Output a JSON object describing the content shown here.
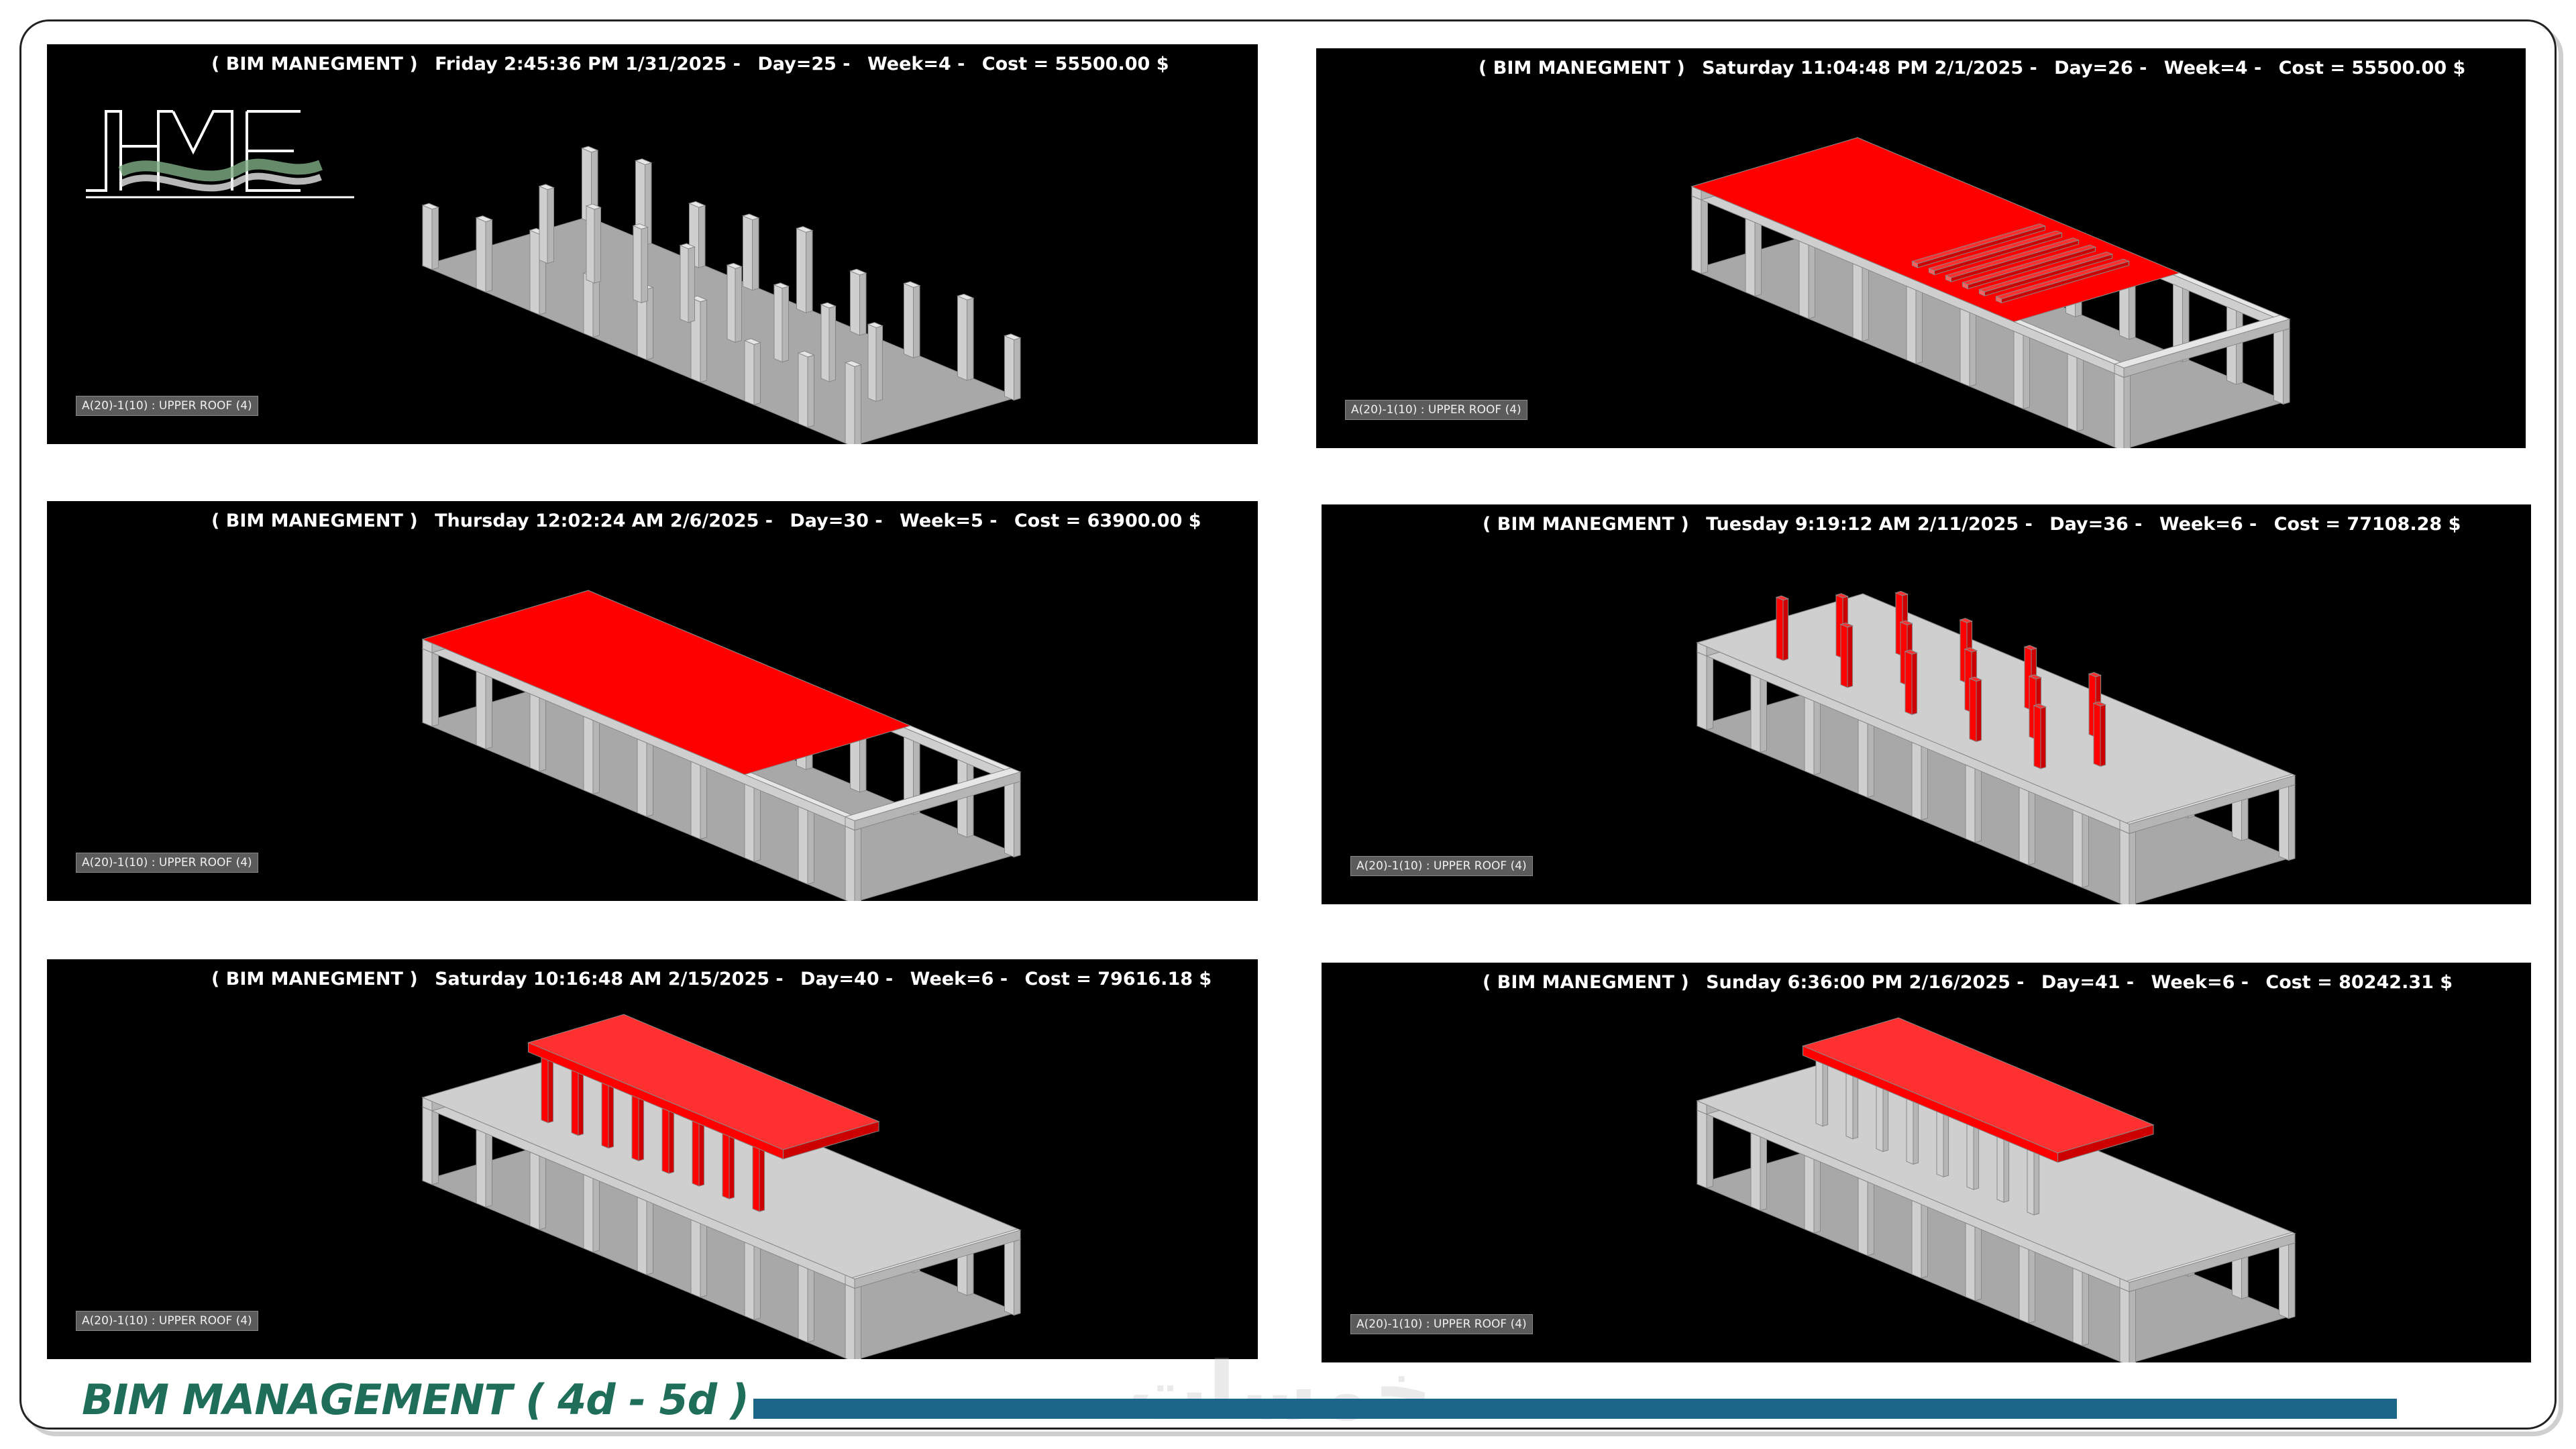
{
  "brand": {
    "logo_text": "HME"
  },
  "footer": {
    "title": "BIM MANAGEMENT ( 4d - 5d )",
    "watermark": "خمسات"
  },
  "colors": {
    "highlight": "#ff0000",
    "structure": "#cfcfcf",
    "slab": "#a8a8a8",
    "footer_bar": "#1c6689",
    "footer_title": "#1f6e5a"
  },
  "panels": [
    {
      "label": "( BIM MANEGMENT )",
      "day_time": "Friday 2:45:36 PM 1/31/2025 -",
      "day": "Day=25 -",
      "week": "Week=4 -",
      "cost": "Cost = 55500.00 $",
      "level": "A(20)-1(10) : UPPER ROOF (4)",
      "highlight": "none"
    },
    {
      "label": "( BIM MANEGMENT )",
      "day_time": "Saturday 11:04:48 PM 2/1/2025 -",
      "day": "Day=26 -",
      "week": "Week=4 -",
      "cost": "Cost = 55500.00 $",
      "level": "A(20)-1(10) : UPPER ROOF (4)",
      "highlight": "upper-formwork"
    },
    {
      "label": "( BIM MANEGMENT )",
      "day_time": "Thursday 12:02:24 AM 2/6/2025 -",
      "day": "Day=30 -",
      "week": "Week=5 -",
      "cost": "Cost = 63900.00 $",
      "level": "A(20)-1(10) : UPPER ROOF (4)",
      "highlight": "slab"
    },
    {
      "label": "( BIM MANEGMENT )",
      "day_time": "Tuesday 9:19:12 AM 2/11/2025 -",
      "day": "Day=36 -",
      "week": "Week=6 -",
      "cost": "Cost = 77108.28 $",
      "level": "A(20)-1(10) : UPPER ROOF (4)",
      "highlight": "columns"
    },
    {
      "label": "( BIM MANEGMENT )",
      "day_time": "Saturday 10:16:48 AM 2/15/2025 -",
      "day": "Day=40 -",
      "week": "Week=6 -",
      "cost": "Cost = 79616.18 $",
      "level": "A(20)-1(10) : UPPER ROOF (4)",
      "highlight": "frame"
    },
    {
      "label": "( BIM MANEGMENT )",
      "day_time": "Sunday 6:36:00 PM 2/16/2025 -",
      "day": "Day=41 -",
      "week": "Week=6 -",
      "cost": "Cost = 80242.31 $",
      "level": "A(20)-1(10) : UPPER ROOF (4)",
      "highlight": "beams"
    }
  ]
}
